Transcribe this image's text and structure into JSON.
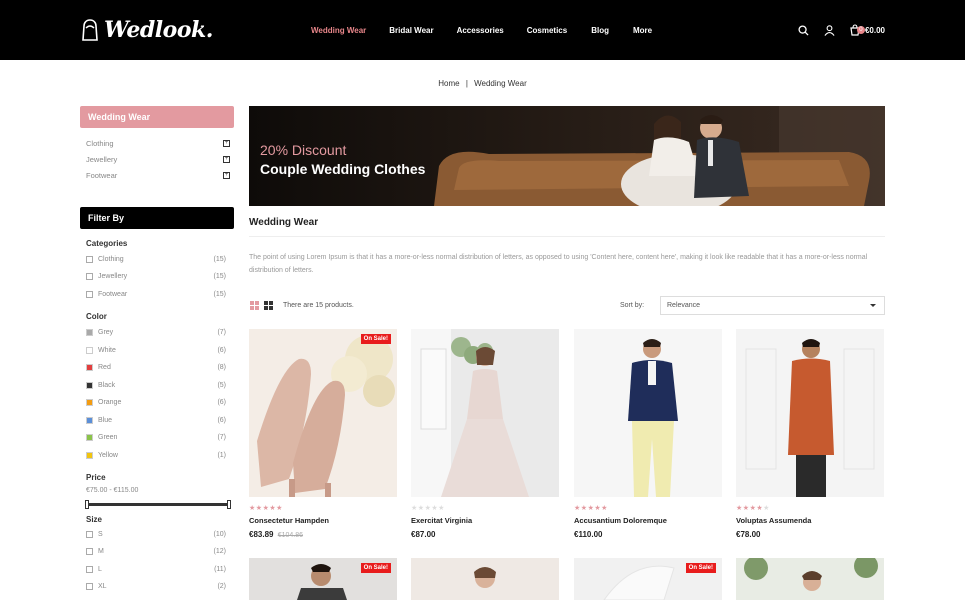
{
  "brand": {
    "logo_text": "Wedlook."
  },
  "nav": {
    "items": [
      {
        "label": "Wedding Wear",
        "active": true
      },
      {
        "label": "Bridal Wear",
        "active": false
      },
      {
        "label": "Accessories",
        "active": false
      },
      {
        "label": "Cosmetics",
        "active": false
      },
      {
        "label": "Blog",
        "active": false
      },
      {
        "label": "More",
        "active": false
      }
    ],
    "cart_price": "€0.00",
    "cart_count": "0"
  },
  "breadcrumb": {
    "home": "Home",
    "separator": "|",
    "current": "Wedding Wear"
  },
  "sidebar": {
    "category_title": "Wedding Wear",
    "categories": [
      {
        "label": "Clothing"
      },
      {
        "label": "Jewellery"
      },
      {
        "label": "Footwear"
      }
    ],
    "filter_title": "Filter By",
    "groups": {
      "categories": {
        "title": "Categories",
        "items": [
          {
            "label": "Clothing",
            "count": "(15)"
          },
          {
            "label": "Jewellery",
            "count": "(15)"
          },
          {
            "label": "Footwear",
            "count": "(15)"
          }
        ]
      },
      "color": {
        "title": "Color",
        "items": [
          {
            "label": "Grey",
            "count": "(7)",
            "color": "#a9a9a9"
          },
          {
            "label": "White",
            "count": "(6)",
            "color": "#ffffff"
          },
          {
            "label": "Red",
            "count": "(8)",
            "color": "#e23e3e"
          },
          {
            "label": "Black",
            "count": "(5)",
            "color": "#333333"
          },
          {
            "label": "Orange",
            "count": "(6)",
            "color": "#f39c12"
          },
          {
            "label": "Blue",
            "count": "(6)",
            "color": "#5b8fd8"
          },
          {
            "label": "Green",
            "count": "(7)",
            "color": "#8bc34a"
          },
          {
            "label": "Yellow",
            "count": "(1)",
            "color": "#f1c40f"
          }
        ]
      },
      "price": {
        "title": "Price",
        "range": "€75.00 - €115.00"
      },
      "size": {
        "title": "Size",
        "items": [
          {
            "label": "S",
            "count": "(10)"
          },
          {
            "label": "M",
            "count": "(12)"
          },
          {
            "label": "L",
            "count": "(11)"
          },
          {
            "label": "XL",
            "count": "(2)"
          }
        ]
      }
    }
  },
  "banner": {
    "subtitle": "20% Discount",
    "title": "Couple Wedding Clothes"
  },
  "main": {
    "title": "Wedding Wear",
    "description": "The point of using Lorem Ipsum is that it has a more-or-less normal distribution of letters, as opposed to using 'Content here, content here', making it look like readable that it has a more-or-less normal distribution of letters.",
    "product_count": "There are 15 products.",
    "sort_label": "Sort by:",
    "sort_value": "Relevance"
  },
  "products": [
    {
      "name": "Consectetur Hampden",
      "price": "€83.89",
      "old_price": "€104.86",
      "rating": 5,
      "on_sale": "On Sale!"
    },
    {
      "name": "Exercitat Virginia",
      "price": "€87.00",
      "old_price": "",
      "rating": 0,
      "on_sale": ""
    },
    {
      "name": "Accusantium Doloremque",
      "price": "€110.00",
      "old_price": "",
      "rating": 5,
      "on_sale": ""
    },
    {
      "name": "Voluptas Assumenda",
      "price": "€78.00",
      "old_price": "",
      "rating": 4,
      "on_sale": ""
    }
  ],
  "row2_sale": "On Sale!",
  "colors": {
    "accent": "#e39aa0",
    "sale": "#e81c1c",
    "header": "#000000"
  }
}
